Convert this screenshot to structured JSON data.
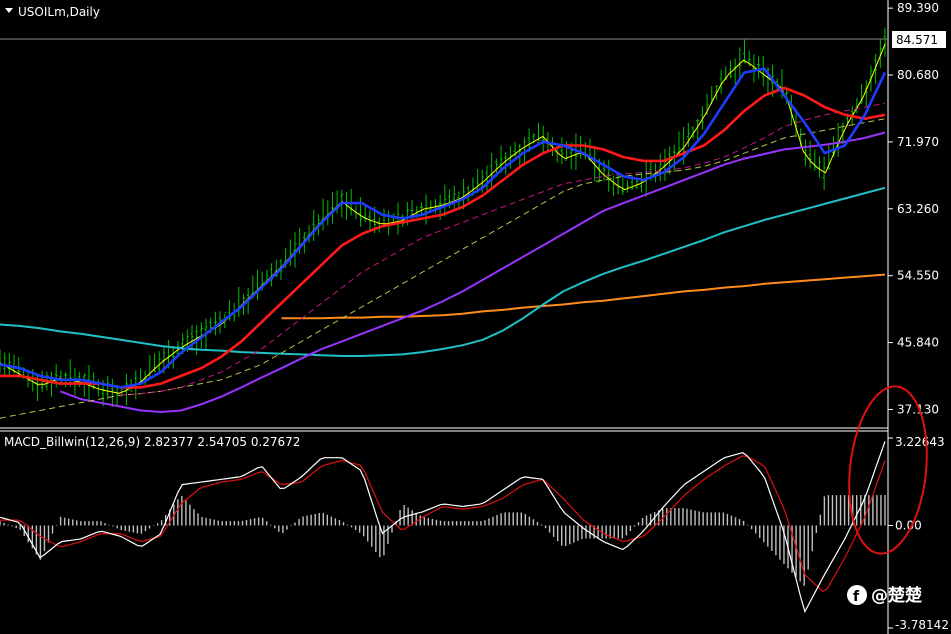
{
  "symbol_title": "USOILm,Daily",
  "indicator_title": "MACD_Billwin(12,26,9) 2.82377 2.54705 0.27672",
  "watermark": "@楚楚",
  "colors": {
    "background": "#000000",
    "candle": "#00c000",
    "ema_fast": "#ffff00",
    "blue_ma": "#1e3cff",
    "red_ma": "#ff1a1a",
    "magenta_ma": "#c71585",
    "olive_ma": "#b8c44a",
    "purple_ma": "#9933ff",
    "cyan_ma": "#20c0c8",
    "orange_ma": "#ff8c1a",
    "macd_line": "#ffffff",
    "signal_line": "#e01010",
    "histogram": "#c0c0c0",
    "annotation": "#e01010"
  },
  "chart_data": [
    {
      "type": "line",
      "title": "USOILm,Daily",
      "price_axis_ticks": [
        "89.390",
        "80.680",
        "71.970",
        "63.260",
        "54.550",
        "45.840",
        "37.130"
      ],
      "ylim": [
        35.5,
        89.8
      ],
      "current_price": "84.571",
      "x": [
        0,
        20,
        40,
        60,
        80,
        100,
        120,
        140,
        160,
        180,
        200,
        220,
        240,
        260,
        280,
        300,
        320,
        340,
        360,
        380,
        400,
        420,
        440,
        460,
        480,
        500,
        520,
        540,
        560,
        580,
        600,
        620,
        640,
        660,
        680,
        700,
        720,
        740,
        760,
        780,
        800,
        820,
        840,
        860,
        880
      ],
      "series": [
        {
          "key": "price",
          "values": [
            43.5,
            42.0,
            40.5,
            41.5,
            41.0,
            40.0,
            39.5,
            41.0,
            43.5,
            45.5,
            47.0,
            48.5,
            51.0,
            53.5,
            56.0,
            59.0,
            62.0,
            64.5,
            62.5,
            61.5,
            62.0,
            63.5,
            64.0,
            65.0,
            67.0,
            69.5,
            71.5,
            73.0,
            70.0,
            71.0,
            68.0,
            66.0,
            67.0,
            69.0,
            71.5,
            75.5,
            80.5,
            83.0,
            81.0,
            79.0,
            70.5,
            68.0,
            74.0,
            78.5,
            85.0
          ]
        },
        {
          "key": "blue_ma",
          "values": [
            43.0,
            42.5,
            41.5,
            41.0,
            41.0,
            40.5,
            40.0,
            40.5,
            42.0,
            44.5,
            46.5,
            48.5,
            50.5,
            53.0,
            55.5,
            58.5,
            61.5,
            64.0,
            64.0,
            62.5,
            62.0,
            62.5,
            63.5,
            64.5,
            66.0,
            68.5,
            70.5,
            72.0,
            71.5,
            70.5,
            69.0,
            67.5,
            67.0,
            68.0,
            70.0,
            73.0,
            77.0,
            81.0,
            81.5,
            78.0,
            74.5,
            70.5,
            71.5,
            75.5,
            81.0
          ]
        },
        {
          "key": "red_ma",
          "values": [
            41.5,
            41.5,
            41.0,
            40.5,
            40.5,
            40.5,
            40.0,
            40.0,
            40.5,
            41.5,
            42.5,
            44.0,
            46.0,
            48.5,
            51.0,
            53.5,
            56.0,
            58.5,
            60.0,
            61.0,
            61.5,
            62.0,
            62.5,
            63.5,
            65.0,
            67.0,
            69.0,
            70.5,
            71.5,
            71.5,
            71.0,
            70.0,
            69.5,
            69.5,
            70.5,
            71.5,
            73.5,
            76.0,
            78.0,
            79.0,
            78.0,
            76.5,
            75.5,
            75.0,
            75.5
          ]
        },
        {
          "key": "magenta_ma",
          "values": [
            null,
            null,
            null,
            null,
            null,
            null,
            39.0,
            39.2,
            39.5,
            40.0,
            41.0,
            42.0,
            43.5,
            45.0,
            47.0,
            49.0,
            51.0,
            53.0,
            55.0,
            56.5,
            58.0,
            59.5,
            60.5,
            61.5,
            62.5,
            63.5,
            64.5,
            65.5,
            66.5,
            67.0,
            67.5,
            67.8,
            68.0,
            68.2,
            68.6,
            69.2,
            70.0,
            71.2,
            72.5,
            74.0,
            74.8,
            75.5,
            76.0,
            76.5,
            77.0
          ]
        },
        {
          "key": "olive_ma",
          "values": [
            36.0,
            36.5,
            37.0,
            37.5,
            38.0,
            38.5,
            39.0,
            39.2,
            39.5,
            40.0,
            40.5,
            41.0,
            42.0,
            43.0,
            44.5,
            46.0,
            47.5,
            49.0,
            50.5,
            52.0,
            53.5,
            55.0,
            56.5,
            58.0,
            59.5,
            61.0,
            62.5,
            64.0,
            65.5,
            66.5,
            67.0,
            67.5,
            67.8,
            68.0,
            68.3,
            68.8,
            69.5,
            70.5,
            71.5,
            72.5,
            73.0,
            73.5,
            74.0,
            74.5,
            75.0
          ]
        },
        {
          "key": "purple_ma",
          "values": [
            null,
            null,
            null,
            39.5,
            38.5,
            38.0,
            37.5,
            37.0,
            36.8,
            37.0,
            37.8,
            38.8,
            40.0,
            41.3,
            42.5,
            43.8,
            45.0,
            46.0,
            47.0,
            48.0,
            49.0,
            50.0,
            51.2,
            52.5,
            54.0,
            55.5,
            57.0,
            58.5,
            60.0,
            61.5,
            63.0,
            64.0,
            65.0,
            66.0,
            67.0,
            68.0,
            69.0,
            69.8,
            70.4,
            71.0,
            71.3,
            71.6,
            72.0,
            72.5,
            73.2
          ]
        },
        {
          "key": "cyan_ma",
          "values": [
            48.2,
            48.0,
            47.7,
            47.3,
            47.0,
            46.6,
            46.2,
            45.8,
            45.4,
            45.1,
            44.9,
            44.8,
            44.6,
            44.5,
            44.4,
            44.3,
            44.2,
            44.1,
            44.1,
            44.2,
            44.3,
            44.6,
            45.0,
            45.5,
            46.2,
            47.4,
            49.0,
            50.8,
            52.5,
            53.7,
            54.8,
            55.7,
            56.5,
            57.4,
            58.3,
            59.2,
            60.2,
            61.0,
            61.8,
            62.5,
            63.2,
            63.9,
            64.6,
            65.3,
            66.0
          ]
        },
        {
          "key": "orange_ma",
          "values": [
            null,
            null,
            null,
            null,
            null,
            null,
            null,
            null,
            null,
            null,
            null,
            null,
            null,
            null,
            49.0,
            49.0,
            49.0,
            49.1,
            49.1,
            49.2,
            49.2,
            49.3,
            49.4,
            49.6,
            49.9,
            50.1,
            50.4,
            50.6,
            50.8,
            51.1,
            51.3,
            51.6,
            51.9,
            52.2,
            52.5,
            52.7,
            53.0,
            53.2,
            53.5,
            53.7,
            53.9,
            54.1,
            54.3,
            54.5,
            54.7
          ]
        }
      ]
    },
    {
      "type": "line",
      "title": "MACD_Billwin(12,26,9) 2.82377 2.54705 0.27672",
      "axis_ticks": [
        "3.22643",
        "0.00",
        "-3.78142"
      ],
      "ylim": [
        -3.78142,
        3.22643
      ],
      "x": [
        0,
        20,
        40,
        60,
        80,
        100,
        120,
        140,
        160,
        180,
        200,
        220,
        240,
        260,
        280,
        300,
        320,
        340,
        360,
        380,
        400,
        420,
        440,
        460,
        480,
        500,
        520,
        540,
        560,
        580,
        600,
        620,
        640,
        660,
        680,
        700,
        720,
        740,
        760,
        780,
        800,
        820,
        840,
        860,
        880
      ],
      "series": [
        {
          "key": "macd",
          "values": [
            0.3,
            0.1,
            -1.2,
            -0.6,
            -0.5,
            -0.2,
            -0.4,
            -0.8,
            -0.3,
            1.5,
            1.6,
            1.7,
            1.8,
            2.2,
            1.3,
            1.8,
            2.5,
            2.5,
            2.0,
            -0.3,
            0.3,
            0.5,
            0.8,
            0.7,
            0.8,
            1.3,
            1.8,
            1.7,
            0.5,
            -0.1,
            -0.6,
            -0.9,
            -0.2,
            0.7,
            1.5,
            2.0,
            2.5,
            2.7,
            1.8,
            -0.3,
            -3.2,
            -1.8,
            -0.5,
            1.0,
            3.1
          ]
        },
        {
          "key": "signal",
          "values": [
            0.2,
            0.2,
            -0.4,
            -0.8,
            -0.6,
            -0.3,
            -0.3,
            -0.6,
            -0.4,
            0.8,
            1.4,
            1.6,
            1.7,
            2.0,
            1.5,
            1.6,
            2.2,
            2.4,
            2.2,
            0.5,
            -0.2,
            0.3,
            0.7,
            0.6,
            0.7,
            1.0,
            1.5,
            1.7,
            1.0,
            0.2,
            -0.3,
            -0.6,
            -0.4,
            0.3,
            1.1,
            1.7,
            2.2,
            2.6,
            2.2,
            0.6,
            -1.8,
            -2.5,
            -1.2,
            0.3,
            2.4
          ]
        }
      ]
    }
  ]
}
